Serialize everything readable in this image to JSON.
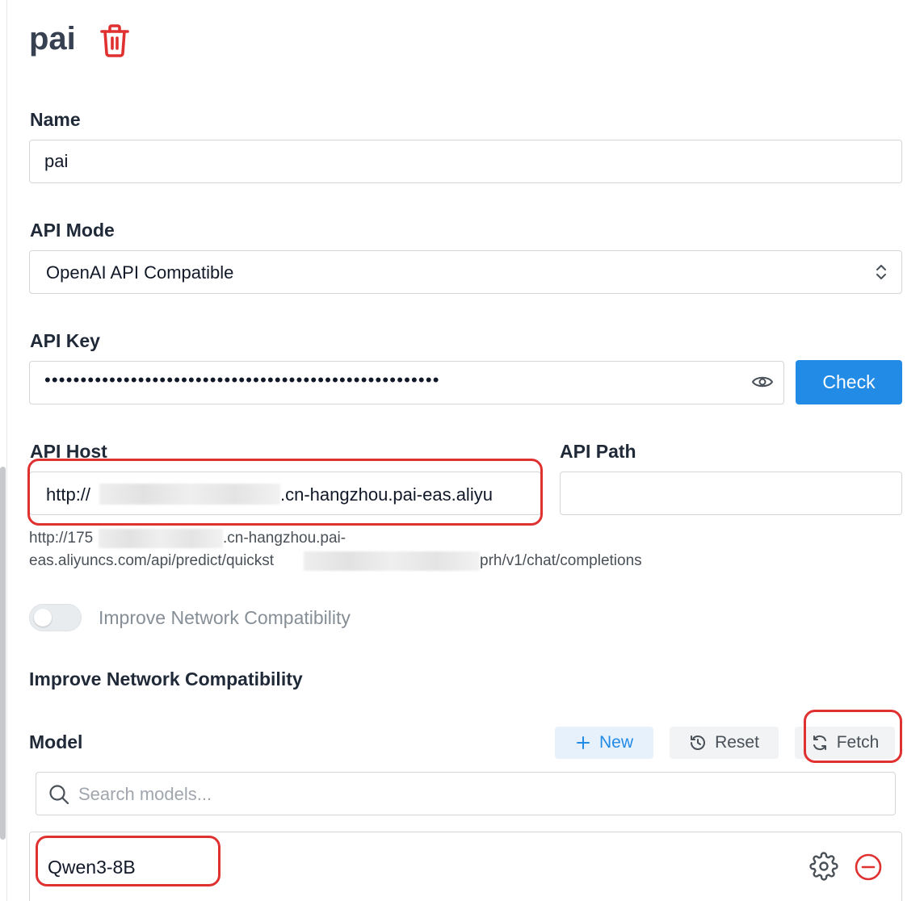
{
  "provider": {
    "title": "pai"
  },
  "icons": {
    "delete": "trash-icon",
    "visibility": "eye-icon",
    "chevron": "chevron-up-down-icon",
    "add": "plus-icon",
    "reset": "reset-icon",
    "fetch": "refresh-icon",
    "search": "search-icon",
    "settings": "gear-icon",
    "remove": "minus-circle-icon"
  },
  "colors": {
    "accent": "#228be6",
    "danger": "#e03131",
    "annotation": "#e03131"
  },
  "form": {
    "name_label": "Name",
    "name_value": "pai",
    "api_mode_label": "API Mode",
    "api_mode_value": "OpenAI API Compatible",
    "api_key_label": "API Key",
    "api_key_value": "•••••••••••••••••••••••••••••••••••••••••••••••••••••••",
    "check_label": "Check",
    "api_host_label": "API Host",
    "api_host_prefix": "http://",
    "api_host_suffix": ".cn-hangzhou.pai-eas.aliyu",
    "api_path_label": "API Path",
    "api_path_value": "",
    "url_preview_line1_prefix": "http://175",
    "url_preview_line1_suffix": ".cn-hangzhou.pai-",
    "url_preview_line2_prefix": "eas.aliyuncs.com/api/predict/quickst",
    "url_preview_line2_suffix": "prh/v1/chat/completions",
    "improve_toggle_label": "Improve Network Compatibility",
    "improve_toggle_on": false,
    "improve_heading": "Improve Network Compatibility"
  },
  "models": {
    "label": "Model",
    "new_label": "New",
    "reset_label": "Reset",
    "fetch_label": "Fetch",
    "search_placeholder": "Search models...",
    "items": [
      {
        "name": "Qwen3-8B"
      }
    ]
  }
}
